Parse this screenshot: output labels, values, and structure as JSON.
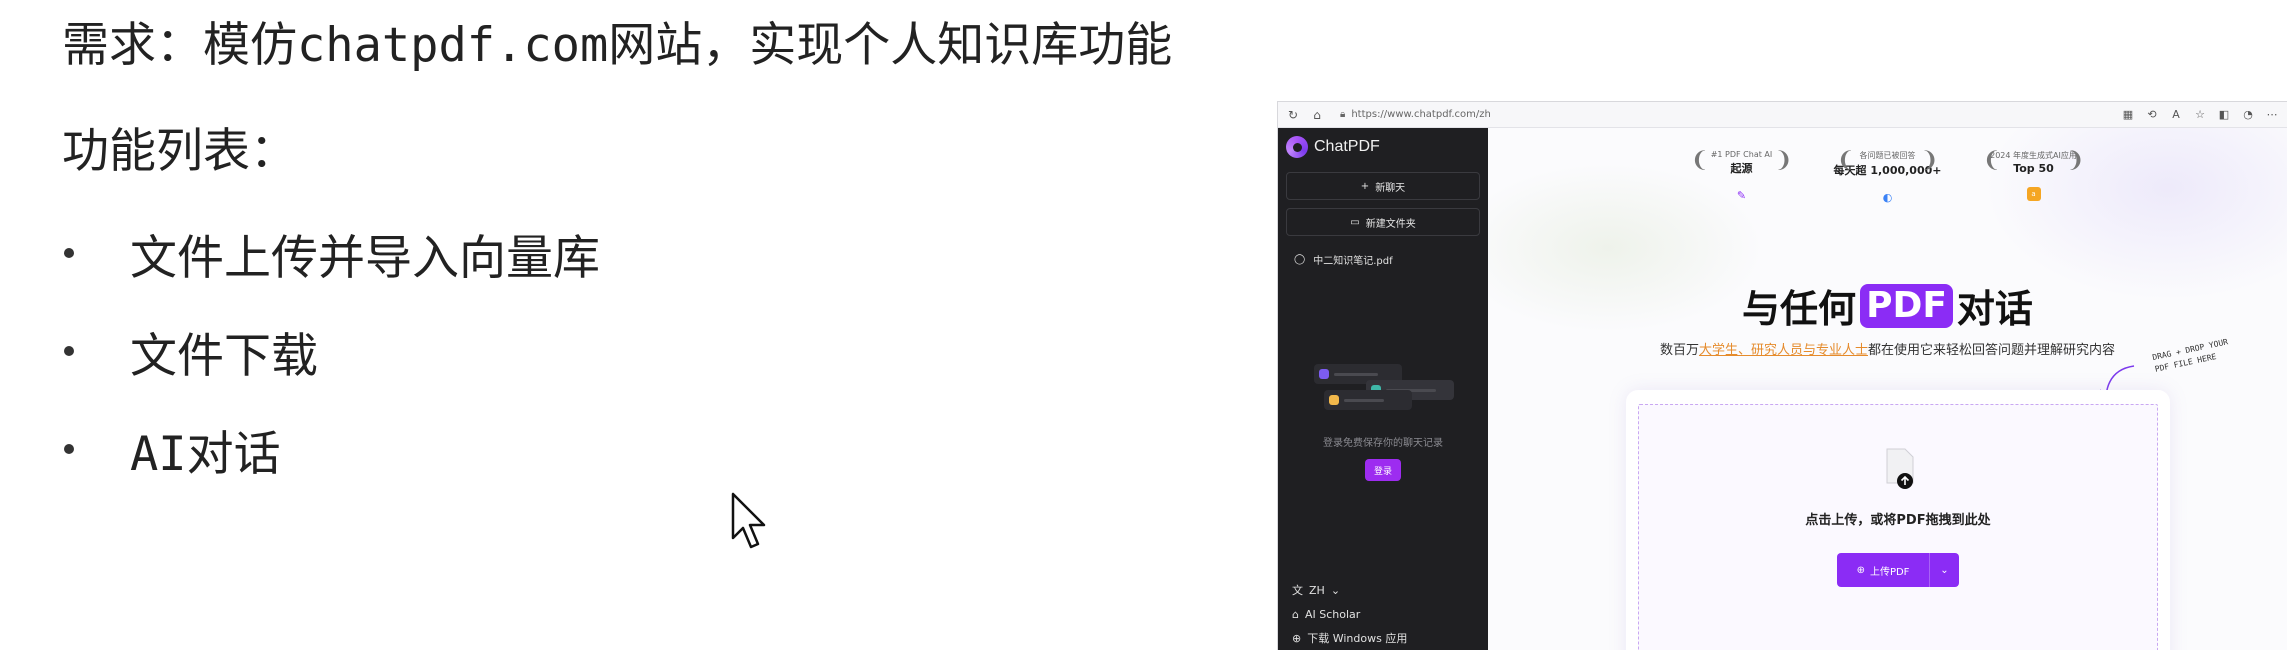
{
  "slide": {
    "title": "需求：模仿chatpdf.com网站，实现个人知识库功能",
    "feature_heading": "功能列表：",
    "features": [
      "文件上传并导入向量库",
      "文件下载",
      "AI对话"
    ]
  },
  "browser": {
    "url": "https://www.chatpdf.com/zh"
  },
  "app": {
    "logo_text": "ChatPDF",
    "new_chat": "新聊天",
    "new_folder": "新建文件夹",
    "file_name": "中二知识笔记.pdf",
    "login_tip": "登录免费保存你的聊天记录",
    "login_button": "登录",
    "language": "ZH",
    "ai_scholar": "AI Scholar",
    "download_windows": "下载 Windows 应用"
  },
  "awards": [
    {
      "sub": "#1 PDF Chat AI",
      "main": "起源"
    },
    {
      "sub": "各问题已被回答",
      "main": "每天超 1,000,000+"
    },
    {
      "sub": "2024 年度生成式AI应用",
      "main": "Top 50"
    }
  ],
  "hero": {
    "title_before": "与任何",
    "title_highlight": "PDF",
    "title_after": "对话",
    "sub_before": "数百万",
    "sub_highlight": "大学生、研究人员与专业人士",
    "sub_after": "都在使用它来轻松回答问题并理解研究内容"
  },
  "drop_note": {
    "line1": "DRAG + DROP YOUR",
    "line2": "PDF FILE HERE"
  },
  "upload": {
    "prompt": "点击上传，或将PDF拖拽到此处",
    "button": "上传PDF"
  },
  "colors": {
    "accent": "#8b2cf5",
    "sidebar_bg": "#1f1f22",
    "highlight_text": "#e58b2c"
  }
}
